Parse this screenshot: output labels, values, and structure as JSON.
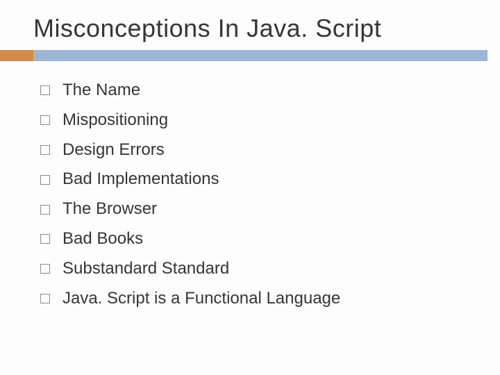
{
  "slide": {
    "title": "Misconceptions In Java. Script",
    "items": [
      "The Name",
      "Mispositioning",
      "Design Errors",
      "Bad Implementations",
      "The Browser",
      "Bad Books",
      "Substandard Standard",
      "Java. Script is a Functional Language"
    ]
  }
}
